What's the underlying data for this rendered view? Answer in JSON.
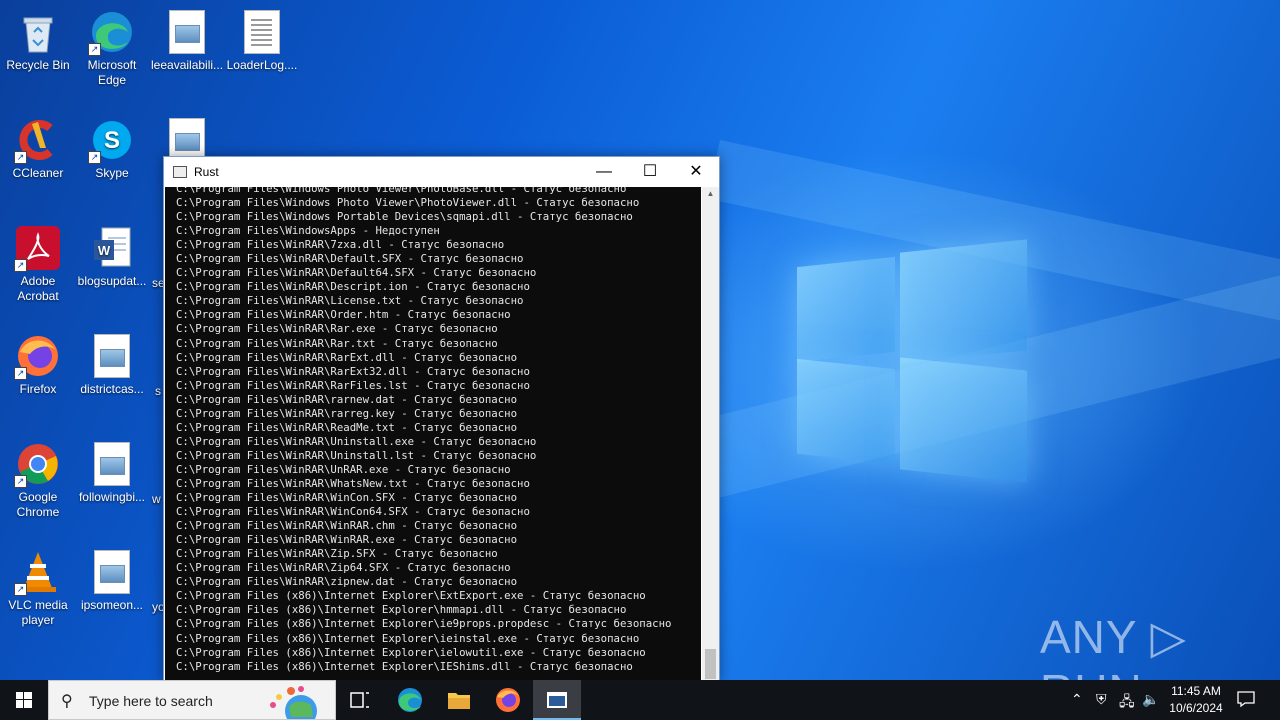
{
  "desktop": {
    "icons": [
      {
        "label": "Recycle Bin"
      },
      {
        "label": "Microsoft Edge"
      },
      {
        "label": "leeavailabili..."
      },
      {
        "label": "LoaderLog...."
      },
      {
        "label": "CCleaner"
      },
      {
        "label": "Skype"
      },
      {
        "label": "Adobe Acrobat"
      },
      {
        "label": "blogsupdat..."
      },
      {
        "label": "Firefox"
      },
      {
        "label": "districtcas..."
      },
      {
        "label": "Google Chrome"
      },
      {
        "label": "followingbi..."
      },
      {
        "label": "VLC media player"
      },
      {
        "label": "ipsomeon..."
      }
    ],
    "partial_labels": [
      "se",
      "s",
      "w",
      "yo"
    ]
  },
  "window": {
    "title": "Rust",
    "minimize_glyph": "—",
    "maximize_glyph": "☐",
    "close_glyph": "✕",
    "console_lines": [
      "C:\\Program Files\\Windows Photo Viewer\\PhotoBase.dll - Статус безопасно",
      "C:\\Program Files\\Windows Photo Viewer\\PhotoViewer.dll - Статус безопасно",
      "C:\\Program Files\\Windows Portable Devices\\sqmapi.dll - Статус безопасно",
      "C:\\Program Files\\WindowsApps - Недоступен",
      "C:\\Program Files\\WinRAR\\7zxa.dll - Статус безопасно",
      "C:\\Program Files\\WinRAR\\Default.SFX - Статус безопасно",
      "C:\\Program Files\\WinRAR\\Default64.SFX - Статус безопасно",
      "C:\\Program Files\\WinRAR\\Descript.ion - Статус безопасно",
      "C:\\Program Files\\WinRAR\\License.txt - Статус безопасно",
      "C:\\Program Files\\WinRAR\\Order.htm - Статус безопасно",
      "C:\\Program Files\\WinRAR\\Rar.exe - Статус безопасно",
      "C:\\Program Files\\WinRAR\\Rar.txt - Статус безопасно",
      "C:\\Program Files\\WinRAR\\RarExt.dll - Статус безопасно",
      "C:\\Program Files\\WinRAR\\RarExt32.dll - Статус безопасно",
      "C:\\Program Files\\WinRAR\\RarFiles.lst - Статус безопасно",
      "C:\\Program Files\\WinRAR\\rarnew.dat - Статус безопасно",
      "C:\\Program Files\\WinRAR\\rarreg.key - Статус безопасно",
      "C:\\Program Files\\WinRAR\\ReadMe.txt - Статус безопасно",
      "C:\\Program Files\\WinRAR\\Uninstall.exe - Статус безопасно",
      "C:\\Program Files\\WinRAR\\Uninstall.lst - Статус безопасно",
      "C:\\Program Files\\WinRAR\\UnRAR.exe - Статус безопасно",
      "C:\\Program Files\\WinRAR\\WhatsNew.txt - Статус безопасно",
      "C:\\Program Files\\WinRAR\\WinCon.SFX - Статус безопасно",
      "C:\\Program Files\\WinRAR\\WinCon64.SFX - Статус безопасно",
      "C:\\Program Files\\WinRAR\\WinRAR.chm - Статус безопасно",
      "C:\\Program Files\\WinRAR\\WinRAR.exe - Статус безопасно",
      "C:\\Program Files\\WinRAR\\Zip.SFX - Статус безопасно",
      "C:\\Program Files\\WinRAR\\Zip64.SFX - Статус безопасно",
      "C:\\Program Files\\WinRAR\\zipnew.dat - Статус безопасно",
      "C:\\Program Files (x86)\\Internet Explorer\\ExtExport.exe - Статус безопасно",
      "C:\\Program Files (x86)\\Internet Explorer\\hmmapi.dll - Статус безопасно",
      "C:\\Program Files (x86)\\Internet Explorer\\ie9props.propdesc - Статус безопасно",
      "C:\\Program Files (x86)\\Internet Explorer\\ieinstal.exe - Статус безопасно",
      "C:\\Program Files (x86)\\Internet Explorer\\ielowutil.exe - Статус безопасно",
      "C:\\Program Files (x86)\\Internet Explorer\\IEShims.dll - Статус безопасно"
    ]
  },
  "watermark": {
    "text": "ANY ▷ RUN"
  },
  "taskbar": {
    "search_placeholder": "Type here to search",
    "apps": [
      "Task View",
      "Microsoft Edge",
      "File Explorer",
      "Firefox",
      "Rust"
    ],
    "clock_time": "11:45 AM",
    "clock_date": "10/6/2024"
  },
  "colors": {
    "console_bg": "#0c0c0c",
    "console_fg": "#e6e6e6",
    "taskbar_bg": "#101318",
    "desktop_blue": "#0b5dd6"
  }
}
